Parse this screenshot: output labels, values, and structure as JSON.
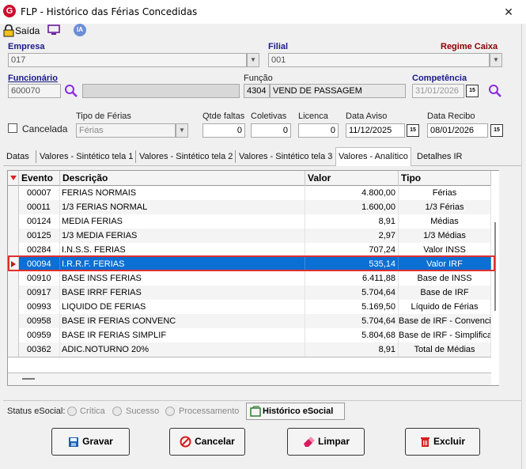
{
  "window": {
    "title": "FLP - Histórico das Férias Concedidas",
    "close_glyph": "✕"
  },
  "toolbar": {
    "exit_label": "Saída",
    "ia_label": "IA"
  },
  "empresa": {
    "label": "Empresa",
    "value": "017"
  },
  "filial": {
    "label": "Filial",
    "value": "001"
  },
  "regime": {
    "label": "Regime Caixa"
  },
  "funcionario": {
    "label": "Funcionário",
    "code": "600070",
    "name": ""
  },
  "funcao": {
    "label": "Função",
    "code": "4304",
    "name": "VEND DE PASSAGEM"
  },
  "competencia": {
    "label": "Competência",
    "value": "31/01/2026"
  },
  "cancelada": {
    "label": "Cancelada"
  },
  "tipo_ferias": {
    "label": "Tipo de Férias",
    "value": "Férias"
  },
  "qtde_faltas": {
    "label": "Qtde faltas",
    "value": "0"
  },
  "coletivas": {
    "label": "Coletivas",
    "value": "0"
  },
  "licenca": {
    "label": "Licenca",
    "value": "0"
  },
  "data_aviso": {
    "label": "Data Aviso",
    "value": "11/12/2025"
  },
  "data_recibo": {
    "label": "Data Recibo",
    "value": "08/01/2026"
  },
  "calendar_glyph": "15",
  "tabs": [
    {
      "label": "Datas"
    },
    {
      "label": "Valores - Sintético tela 1"
    },
    {
      "label": "Valores - Sintético tela 2"
    },
    {
      "label": "Valores - Sintético tela 3"
    },
    {
      "label": "Valores - Analítico"
    },
    {
      "label": "Detalhes IR"
    }
  ],
  "grid": {
    "columns": [
      "Evento",
      "Descrição",
      "Valor",
      "Tipo"
    ],
    "rows": [
      {
        "evento": "00007",
        "descricao": "FERIAS NORMAIS",
        "valor": "4.800,00",
        "tipo": "Férias"
      },
      {
        "evento": "00011",
        "descricao": "1/3 FERIAS NORMAL",
        "valor": "1.600,00",
        "tipo": "1/3 Férias"
      },
      {
        "evento": "00124",
        "descricao": "MEDIA FERIAS",
        "valor": "8,91",
        "tipo": "Médias"
      },
      {
        "evento": "00125",
        "descricao": "1/3 MEDIA FERIAS",
        "valor": "2,97",
        "tipo": "1/3 Médias"
      },
      {
        "evento": "00284",
        "descricao": "I.N.S.S. FERIAS",
        "valor": "707,24",
        "tipo": "Valor INSS"
      },
      {
        "evento": "00094",
        "descricao": "I.R.R.F. FERIAS",
        "valor": "535,14",
        "tipo": "Valor IRF"
      },
      {
        "evento": "00910",
        "descricao": "BASE INSS FERIAS",
        "valor": "6.411,88",
        "tipo": "Base de INSS"
      },
      {
        "evento": "00917",
        "descricao": "BASE IRRF FERIAS",
        "valor": "5.704,64",
        "tipo": "Base de IRF"
      },
      {
        "evento": "00993",
        "descricao": "LIQUIDO DE FERIAS",
        "valor": "5.169,50",
        "tipo": "Líquido de Férias"
      },
      {
        "evento": "00958",
        "descricao": "BASE IR FERIAS CONVENC",
        "valor": "5.704,64",
        "tipo": "Base de IRF - Convenci"
      },
      {
        "evento": "00959",
        "descricao": "BASE IR FERIAS SIMPLIF",
        "valor": "5.804,68",
        "tipo": "Base de IRF - Simplifica"
      },
      {
        "evento": "00362",
        "descricao": "ADIC.NOTURNO 20%",
        "valor": "8,91",
        "tipo": "Total de Médias"
      }
    ]
  },
  "status": {
    "label": "Status eSocial:",
    "options": [
      "Crítica",
      "Sucesso",
      "Processamento"
    ],
    "history_button": "Histórico eSocial"
  },
  "actions": {
    "save": "Gravar",
    "cancel": "Cancelar",
    "clear": "Limpar",
    "delete": "Excluir"
  },
  "colors": {
    "selected_row": "#0b6fd3",
    "highlight_outline": "#e03030",
    "label_blue": "#1a1a8c",
    "label_red": "#8b0000"
  }
}
